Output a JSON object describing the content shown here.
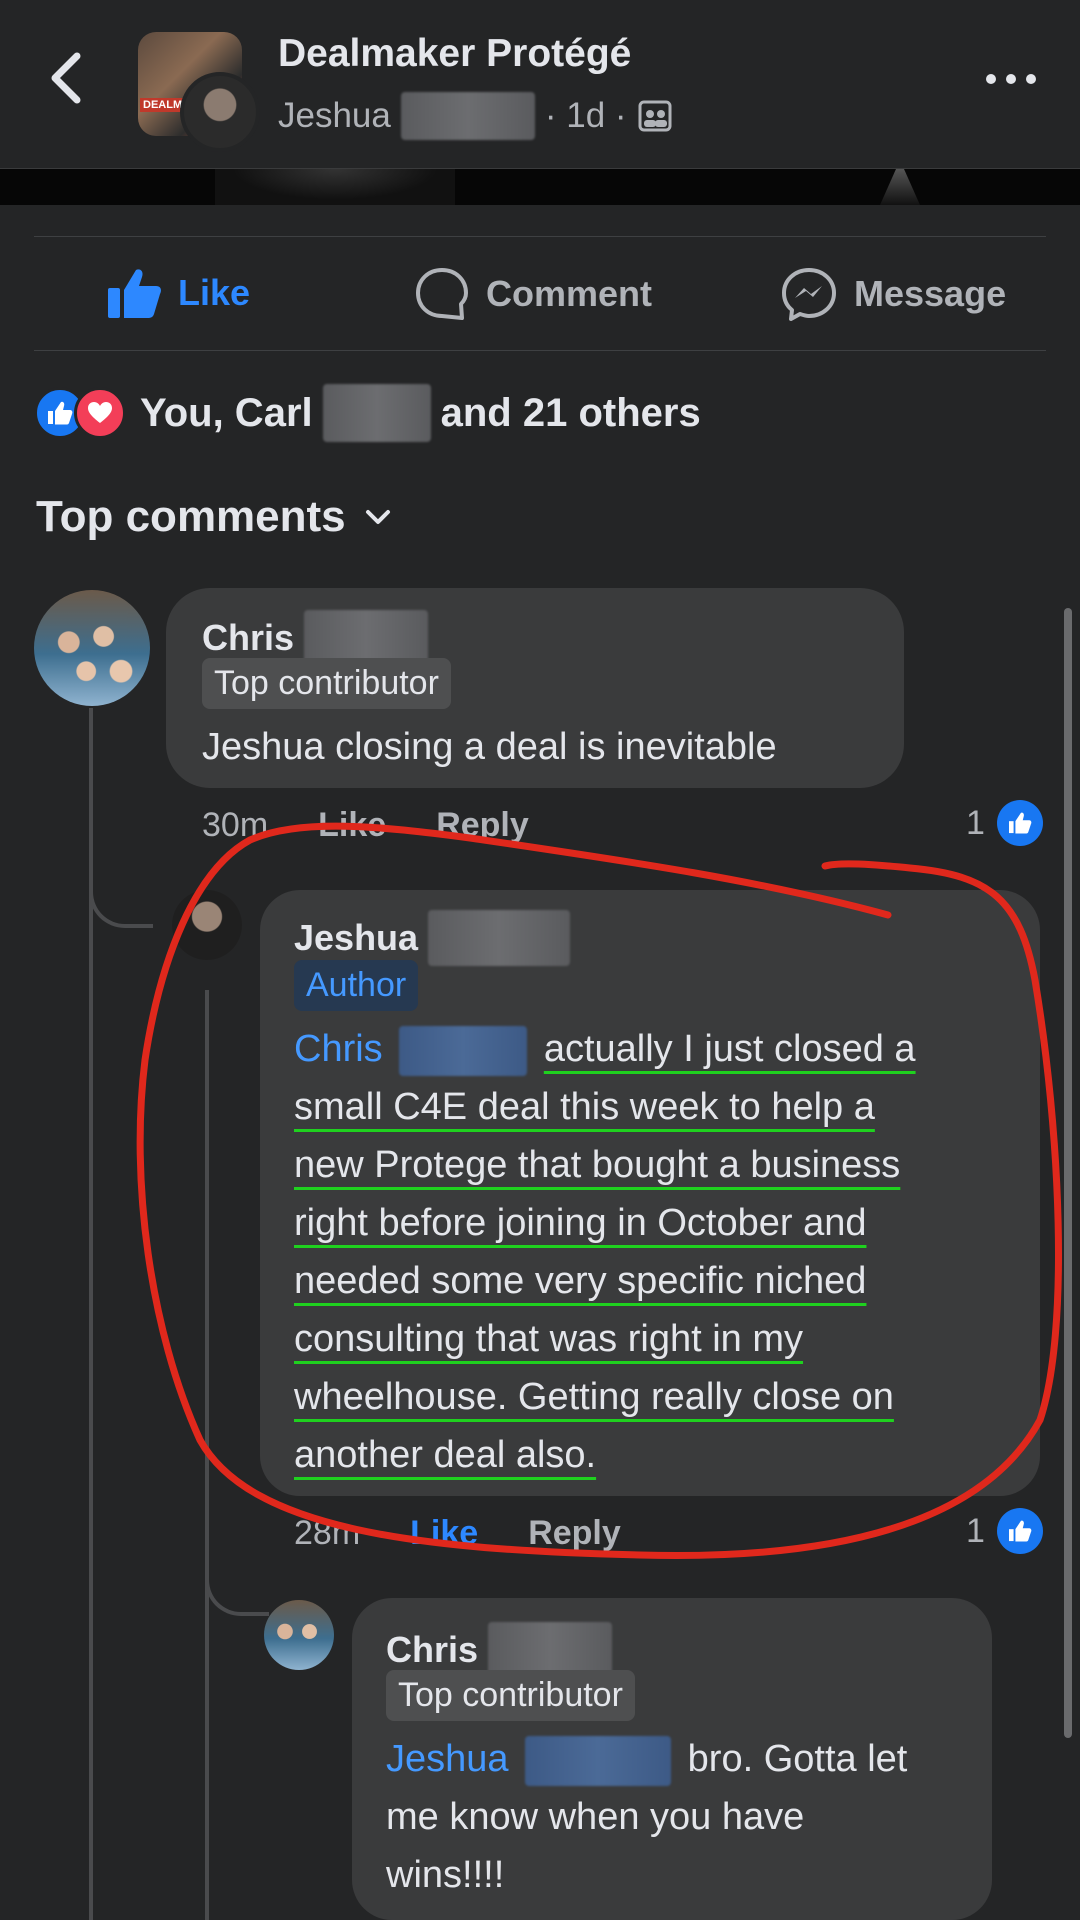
{
  "header": {
    "group_name": "Dealmaker Protégé",
    "poster_first_name": "Jeshua",
    "time_ago": "· 1d ·",
    "group_logo_text": "DEALMAK",
    "icons": [
      "back-chevron-icon",
      "group-privacy-icon",
      "more-options-icon"
    ]
  },
  "actions": {
    "like_label": "Like",
    "comment_label": "Comment",
    "message_label": "Message"
  },
  "reactions": {
    "text_prefix": "You, Carl",
    "text_suffix": "and 21 others",
    "icons": [
      "like-reaction-icon",
      "love-reaction-icon"
    ]
  },
  "comments_section": {
    "sort_label": "Top comments"
  },
  "comments": [
    {
      "name": "Chris",
      "badge": "Top contributor",
      "text": "Jeshua closing a deal is inevitable",
      "time": "30m",
      "like_label": "Like",
      "reply_label": "Reply",
      "like_count": "1"
    },
    {
      "name": "Jeshua",
      "badge": "Author",
      "mention": "Chris",
      "lines": [
        "actually I just closed a",
        "small C4E deal this week to help a",
        "new Protege that bought a business",
        "right before joining in October and",
        "needed some very specific niched",
        "consulting that was right in my",
        "wheelhouse. Getting really close on",
        "another deal also."
      ],
      "time": "28m",
      "like_label": "Like",
      "reply_label": "Reply",
      "like_count": "1"
    },
    {
      "name": "Chris",
      "badge": "Top contributor",
      "mention": "Jeshua",
      "text_after_mention": "bro.  Gotta let",
      "lines": [
        "me know when you have",
        "wins!!!!"
      ]
    }
  ],
  "colors": {
    "background": "#242526",
    "bubble": "#3a3b3c",
    "accent_blue": "#2d88ff",
    "annotation_red": "#e0281c",
    "underline_green": "#1fd11f"
  }
}
